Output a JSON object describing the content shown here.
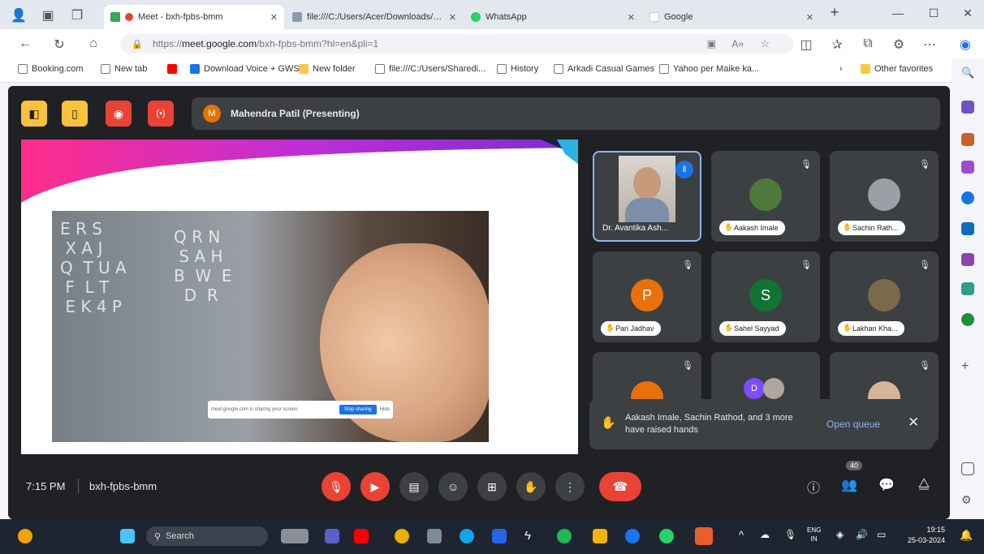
{
  "tabs": [
    {
      "title": "Meet - bxh-fpbs-bmm",
      "active": true
    },
    {
      "title": "file:///C:/Users/Acer/Downloads/NCE...",
      "active": false
    },
    {
      "title": "WhatsApp",
      "active": false
    },
    {
      "title": "Google",
      "active": false
    }
  ],
  "address": {
    "scheme": "https://",
    "host": "meet.google.com",
    "path": "/bxh-fpbs-bmm?hl=en&pli=1"
  },
  "bookmarks": [
    {
      "label": "Booking.com",
      "color": "#5f6368"
    },
    {
      "label": "New tab",
      "color": "#5f6368"
    },
    {
      "label": "",
      "color": "#ff0000"
    },
    {
      "label": "Download Voice + GWS...",
      "color": "#1a73e8"
    },
    {
      "label": "New folder",
      "color": "#f9c846"
    },
    {
      "label": "file:///C:/Users/Sharedi...",
      "color": "#5f6368"
    },
    {
      "label": "History",
      "color": "#5f6368"
    },
    {
      "label": "Arkadi Casual Games",
      "color": "#5f6368"
    },
    {
      "label": "Yahoo per Maike ka...",
      "color": "#5f6368"
    }
  ],
  "other_favorites": "Other favorites",
  "meet": {
    "presenter": "Mahendra Patil (Presenting)",
    "presenter_initial": "M",
    "time": "7:15 PM",
    "code": "bxh-fpbs-bmm",
    "participants": [
      {
        "name": "Dr. Avantika Ash...",
        "kind": "video",
        "color": "#8ab4f8",
        "initial": ""
      },
      {
        "name": "Aakash Imale",
        "kind": "photo",
        "color": "#4d7a3a",
        "initial": ""
      },
      {
        "name": "Sachin Rath...",
        "kind": "photo",
        "color": "#9aa0a6",
        "initial": ""
      },
      {
        "name": "Pari Jadhav",
        "kind": "letter",
        "color": "#e8710a",
        "initial": "P"
      },
      {
        "name": "Sahel Sayyad",
        "kind": "letter",
        "color": "#137333",
        "initial": "S"
      },
      {
        "name": "Lakhan Kha...",
        "kind": "photo",
        "color": "#7a6a4a",
        "initial": ""
      },
      {
        "name": "",
        "kind": "letter",
        "color": "#e8710a",
        "initial": ""
      },
      {
        "name": "",
        "kind": "letter",
        "color": "#7c4dff",
        "initial": "D"
      },
      {
        "name": "",
        "kind": "photo",
        "color": "#d7b59a",
        "initial": ""
      }
    ],
    "hands_notice": "Aakash Imale, Sachin Rathod, and 3 more have raised hands",
    "open_queue": "Open queue",
    "people_count": "40",
    "slide_tooltip": "meet.google.com is sharing your screen.",
    "slide_tooltip_btn": "Stop sharing",
    "slide_tooltip_hide": "Hide",
    "slide_letters": [
      "E R S\n X A J\nQ  T U A\n F  L T\n E K 4 P",
      "Q R N\n S A H\nB  W  E\n  D  R"
    ]
  },
  "taskbar": {
    "search": "Search",
    "lang": "ENG\nIN",
    "clock_time": "19:15",
    "clock_date": "25-03-2024"
  },
  "colors": {
    "meet_bg": "#202124",
    "tile_bg": "#3c4043",
    "red": "#ea4335",
    "yellow": "#f9c23c"
  }
}
